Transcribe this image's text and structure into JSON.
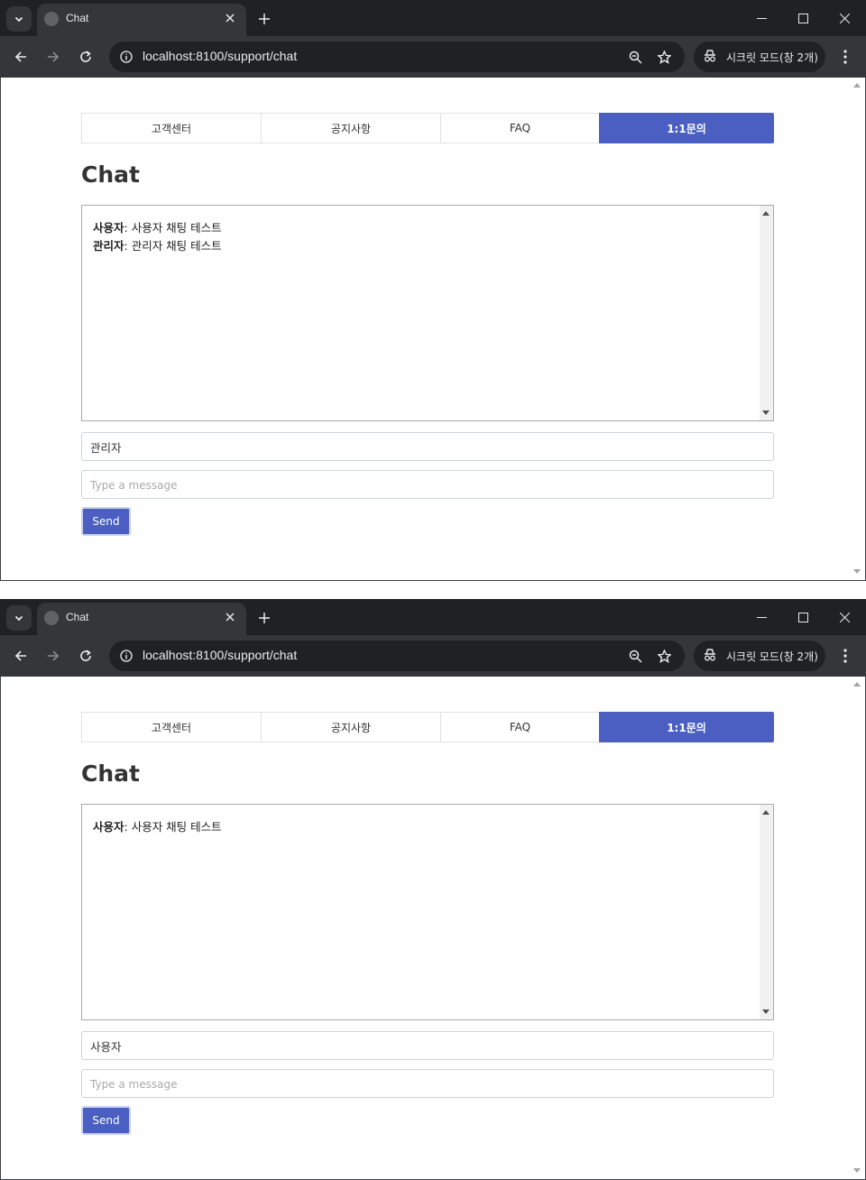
{
  "windows": [
    {
      "tab_title": "Chat",
      "url": "localhost:8100/support/chat",
      "incognito_label": "시크릿 모드(창 2개)",
      "nav_tabs": [
        "고객센터",
        "공지사항",
        "FAQ",
        "1:1문의"
      ],
      "active_tab": "1:1문의",
      "heading": "Chat",
      "messages": [
        {
          "sender": "사용자",
          "text": ": 사용자 채팅 테스트"
        },
        {
          "sender": "관리자",
          "text": ": 관리자 채팅 테스트"
        }
      ],
      "sender_value": "관리자",
      "message_placeholder": "Type a message",
      "send_label": "Send"
    },
    {
      "tab_title": "Chat",
      "url": "localhost:8100/support/chat",
      "incognito_label": "시크릿 모드(창 2개)",
      "nav_tabs": [
        "고객센터",
        "공지사항",
        "FAQ",
        "1:1문의"
      ],
      "active_tab": "1:1문의",
      "heading": "Chat",
      "messages": [
        {
          "sender": "사용자",
          "text": ": 사용자 채팅 테스트"
        }
      ],
      "sender_value": "사용자",
      "message_placeholder": "Type a message",
      "send_label": "Send"
    }
  ],
  "colors": {
    "accent": "#4a5fc1",
    "chrome_dark": "#202124",
    "chrome_toolbar": "#35363a"
  },
  "icons": [
    "tab-search-icon",
    "globe-icon",
    "close-icon",
    "plus-icon",
    "minimize-icon",
    "maximize-icon",
    "back-icon",
    "forward-icon",
    "reload-icon",
    "info-icon",
    "zoom-icon",
    "star-icon",
    "incognito-icon",
    "kebab-menu-icon"
  ]
}
